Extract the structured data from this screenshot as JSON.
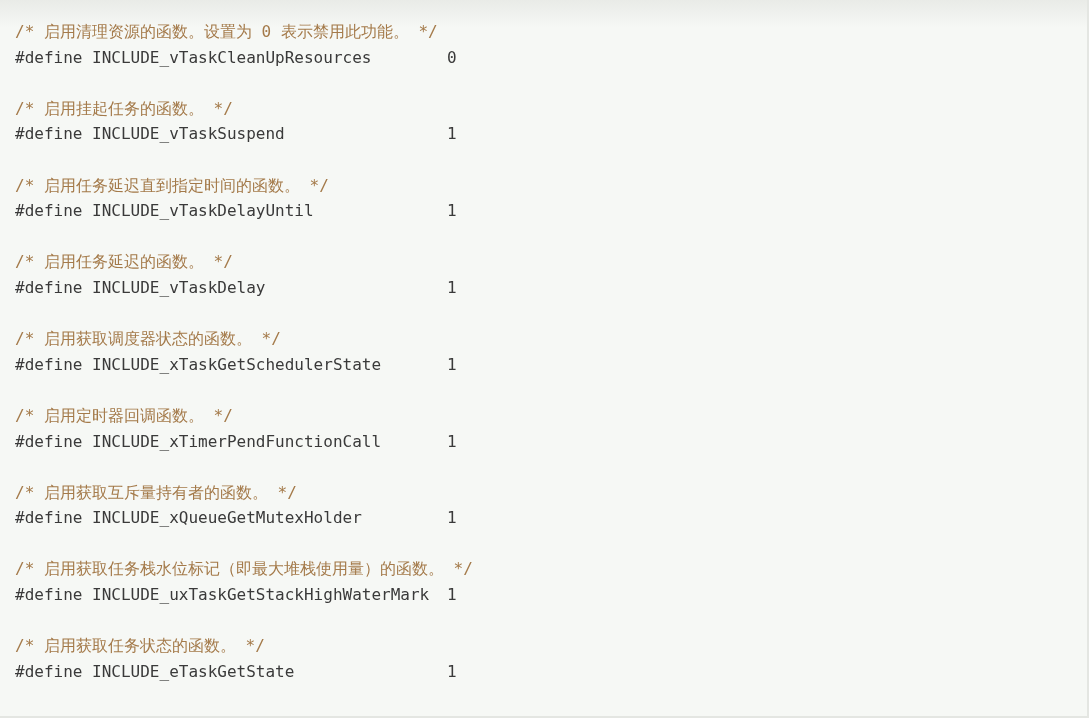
{
  "code_block": {
    "entries": [
      {
        "comment": "/* 启用清理资源的函数。设置为 0 表示禁用此功能。 */",
        "define": "#define INCLUDE_vTaskCleanUpResources",
        "value": "0"
      },
      {
        "comment": "/* 启用挂起任务的函数。 */",
        "define": "#define INCLUDE_vTaskSuspend",
        "value": "1"
      },
      {
        "comment": "/* 启用任务延迟直到指定时间的函数。 */",
        "define": "#define INCLUDE_vTaskDelayUntil",
        "value": "1"
      },
      {
        "comment": "/* 启用任务延迟的函数。 */",
        "define": "#define INCLUDE_vTaskDelay",
        "value": "1"
      },
      {
        "comment": "/* 启用获取调度器状态的函数。 */",
        "define": "#define INCLUDE_xTaskGetSchedulerState",
        "value": "1"
      },
      {
        "comment": "/* 启用定时器回调函数。 */",
        "define": "#define INCLUDE_xTimerPendFunctionCall",
        "value": "1"
      },
      {
        "comment": "/* 启用获取互斥量持有者的函数。 */",
        "define": "#define INCLUDE_xQueueGetMutexHolder",
        "value": "1"
      },
      {
        "comment": "/* 启用获取任务栈水位标记（即最大堆栈使用量）的函数。 */",
        "define": "#define INCLUDE_uxTaskGetStackHighWaterMark",
        "value": "1"
      },
      {
        "comment": "/* 启用获取任务状态的函数。 */",
        "define": "#define INCLUDE_eTaskGetState",
        "value": "1"
      }
    ]
  }
}
